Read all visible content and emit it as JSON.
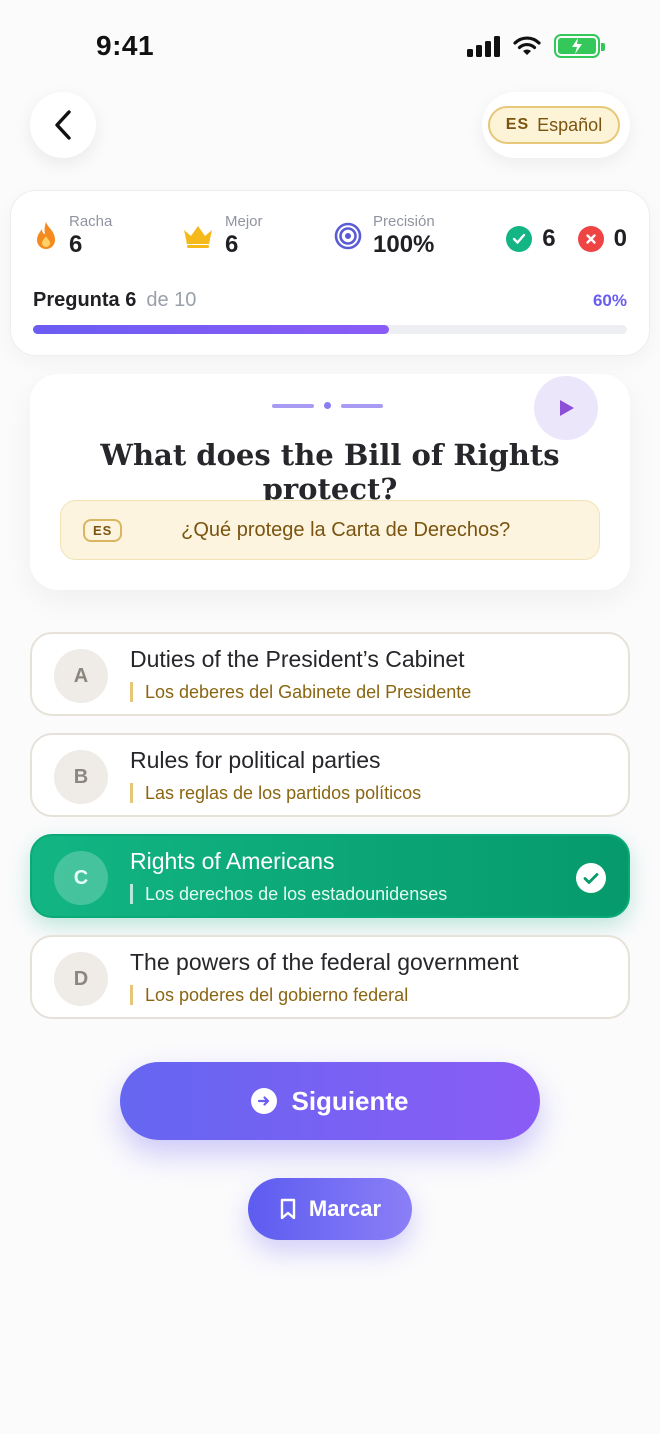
{
  "status_bar": {
    "time": "9:41"
  },
  "header": {
    "language_code": "ES",
    "language_label": "Español"
  },
  "stats": {
    "streak": {
      "label": "Racha",
      "value": "6"
    },
    "best": {
      "label": "Mejor",
      "value": "6"
    },
    "accuracy": {
      "label": "Precisión",
      "value": "100%"
    },
    "correct_count": "6",
    "wrong_count": "0"
  },
  "progress": {
    "question_label": "Pregunta 6",
    "of_label": "de 10",
    "percent_label": "60%",
    "fraction": 0.6
  },
  "question": {
    "text": "What does the Bill of Rights protect?",
    "translation_tag": "ES",
    "translation": "¿Qué protege la Carta de Derechos?"
  },
  "options": [
    {
      "letter": "A",
      "text": "Duties of the President’s Cabinet",
      "translation": "Los deberes del Gabinete del Presidente"
    },
    {
      "letter": "B",
      "text": "Rules for political parties",
      "translation": "Las reglas de los partidos políticos"
    },
    {
      "letter": "C",
      "text": "Rights of Americans",
      "translation": "Los derechos de los estadounidenses",
      "correct": true
    },
    {
      "letter": "D",
      "text": "The powers of the federal government",
      "translation": "Los poderes del gobierno federal"
    }
  ],
  "buttons": {
    "next_label": "Siguiente",
    "mark_label": "Marcar"
  },
  "colors": {
    "accent": "#6b5cf3",
    "correct": "#12b583",
    "wrong": "#ef4444",
    "gold": "#7a5410"
  }
}
